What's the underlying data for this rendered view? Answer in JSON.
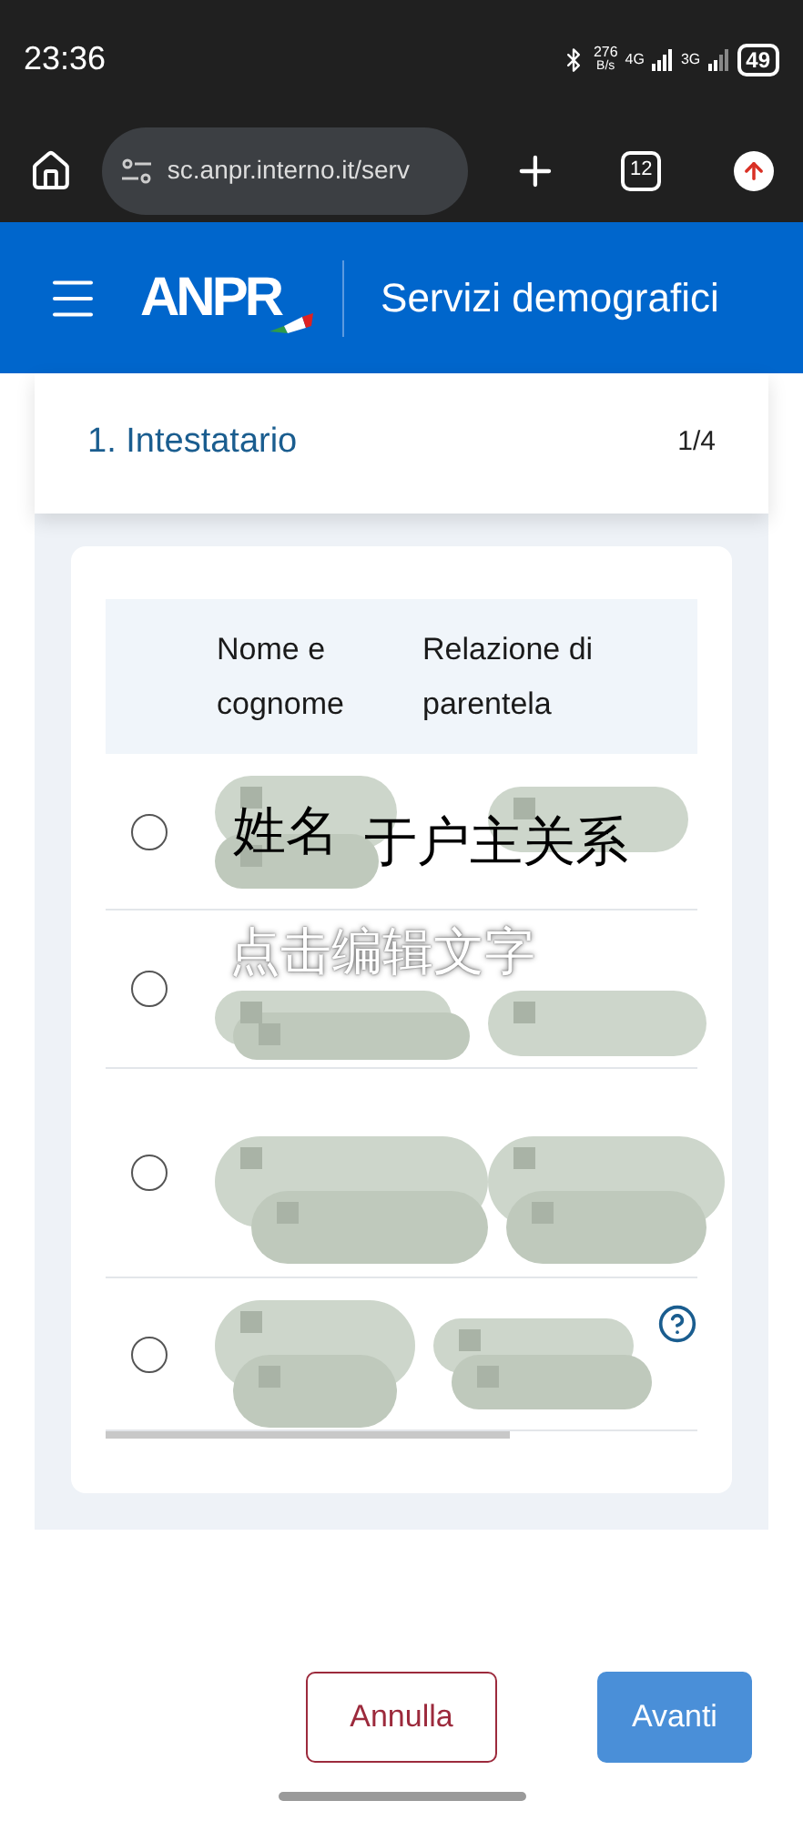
{
  "status_bar": {
    "time": "23:36",
    "speed": "276",
    "speed_unit": "B/s",
    "network_1": "4G",
    "network_2": "3G",
    "battery": "49"
  },
  "browser": {
    "url": "sc.anpr.interno.it/serv",
    "tab_count": "12"
  },
  "header": {
    "logo": "ANPR",
    "title": "Servizi demografici"
  },
  "step": {
    "title": "1. Intestatario",
    "counter": "1/4"
  },
  "table": {
    "columns": [
      "Nome e cognome",
      "Relazione di parentela"
    ],
    "rows": [
      {
        "selected": false,
        "annotations": [
          "姓名",
          "于户主关系"
        ],
        "help": false
      },
      {
        "selected": false,
        "help": false
      },
      {
        "selected": false,
        "help": false
      },
      {
        "selected": false,
        "help": true
      }
    ]
  },
  "overlay_hint": "点击编辑文字",
  "buttons": [
    {
      "label": "Annulla",
      "kind": "secondary"
    },
    {
      "label": "Avanti",
      "kind": "primary"
    }
  ]
}
